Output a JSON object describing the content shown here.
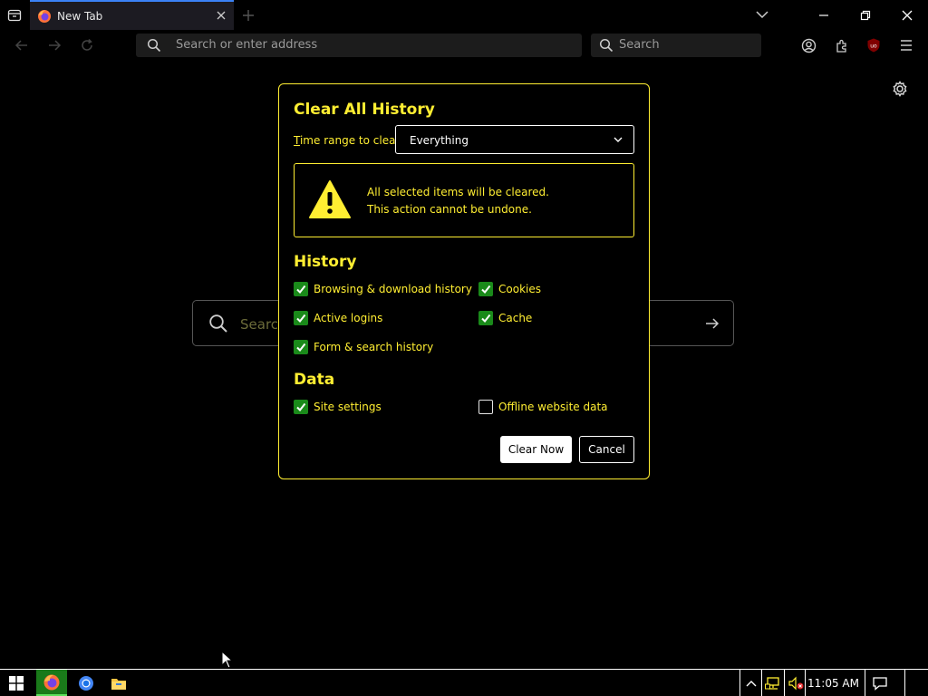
{
  "browser": {
    "tab": {
      "title": "New Tab"
    },
    "urlbar": {
      "placeholder": "Search or enter address"
    },
    "searchbar": {
      "placeholder": "Search"
    },
    "addon_badge": "uo"
  },
  "page": {
    "search_placeholder": "Search"
  },
  "dialog": {
    "title": "Clear All History",
    "time_range_label": "Time range to clear:",
    "time_range_value": "Everything",
    "warning_line1": "All selected items will be cleared.",
    "warning_line2": "This action cannot be undone.",
    "history_heading": "History",
    "data_heading": "Data",
    "options": {
      "browsing_download": {
        "label": "Browsing & download history",
        "checked": true
      },
      "cookies": {
        "label": "Cookies",
        "checked": true
      },
      "active_logins": {
        "label": "Active logins",
        "checked": true
      },
      "cache": {
        "label": "Cache",
        "checked": true
      },
      "form_search": {
        "label": "Form & search history",
        "checked": true
      },
      "site_settings": {
        "label": "Site settings",
        "checked": true
      },
      "offline_data": {
        "label": "Offline website data",
        "checked": false
      }
    },
    "clear_button": "Clear Now",
    "cancel_button": "Cancel"
  },
  "taskbar": {
    "clock": "11:05 AM",
    "apps": [
      "firefox-icon",
      "chrome-icon",
      "file-explorer-icon"
    ]
  },
  "colors": {
    "accent_yellow": "#ffee32",
    "check_green": "#1a8a1a",
    "tab_indicator": "#3b82f6"
  }
}
